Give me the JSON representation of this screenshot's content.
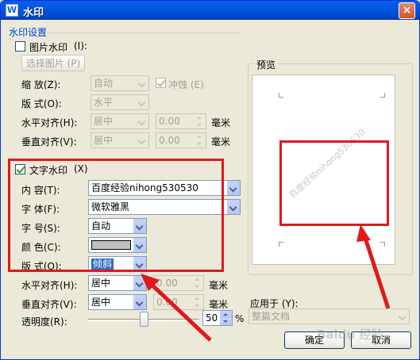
{
  "window": {
    "title": "水印",
    "app_icon": "W",
    "close_glyph": "×"
  },
  "watermark_settings": {
    "group_title": "水印设置",
    "picture": {
      "checkbox_label": "图片水印",
      "checkbox_hotkey": "(I):",
      "checked": false,
      "choose_button": "选择图片 (P)",
      "scale_label": "缩  放(Z):",
      "scale_value": "自动",
      "washout_label": "冲蚀 (E)",
      "washout_checked": true,
      "layout_label": "版  式(O):",
      "layout_value": "水平",
      "h_align_label": "水平对齐(H):",
      "h_align_value": "居中",
      "h_offset": "0.00",
      "h_unit": "毫米",
      "v_align_label": "垂直对齐(V):",
      "v_align_value": "居中",
      "v_offset": "0.00",
      "v_unit": "毫米"
    },
    "text": {
      "checkbox_label": "文字水印",
      "checkbox_hotkey": "(X)",
      "checked": true,
      "content_label": "内  容(T):",
      "content_value": "百度经验nihong530530",
      "font_label": "字  体(F):",
      "font_value": "微软雅黑",
      "size_label": "字  号(S):",
      "size_value": "自动",
      "color_label": "颜  色(C):",
      "color_value": "#c0c0c0",
      "layout_label": "版  式(O):",
      "layout_value": "倾斜",
      "h_align_label": "水平对齐(H):",
      "h_align_value": "居中",
      "h_offset": "0.00",
      "h_unit": "毫米",
      "v_align_label": "垂直对齐(V):",
      "v_align_value": "居中",
      "v_offset": "0.00",
      "v_unit": "毫米",
      "transparency_label": "透明度(R):",
      "transparency_value": "50",
      "transparency_unit": "%"
    }
  },
  "preview": {
    "title": "预览",
    "watermark_text": "百度经验nihong530530"
  },
  "apply_to": {
    "label": "应用于 (Y):",
    "value": "整篇文档"
  },
  "buttons": {
    "ok": "确定",
    "cancel": "取消"
  },
  "annotation": {
    "color": "#e0181e"
  },
  "site_watermark": "Baidu 经验"
}
